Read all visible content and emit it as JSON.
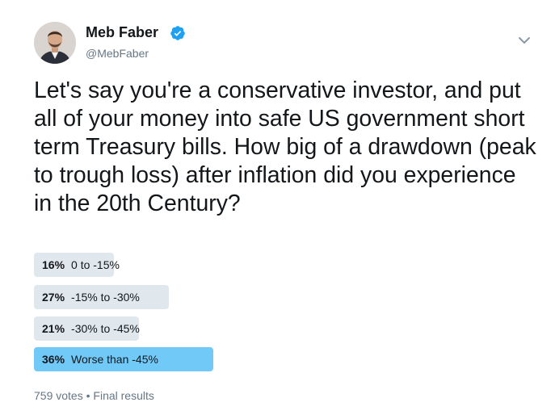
{
  "author": {
    "name": "Meb Faber",
    "handle": "@MebFaber",
    "verified": true,
    "badge_color": "#1da1f2"
  },
  "tweet": {
    "text": "Let's say you're a conservative investor, and put all of your money into safe US government short term Treasury bills.  How big of a drawdown (peak to trough loss) after inflation did you experience in the 20th Century?"
  },
  "poll": {
    "options": [
      {
        "percent_label": "16%",
        "label": "0 to -15%",
        "percent": 16,
        "winner": false
      },
      {
        "percent_label": "27%",
        "label": "-15% to -30%",
        "percent": 27,
        "winner": false
      },
      {
        "percent_label": "21%",
        "label": "-30% to -45%",
        "percent": 21,
        "winner": false
      },
      {
        "percent_label": "36%",
        "label": "Worse than -45%",
        "percent": 36,
        "winner": true
      }
    ],
    "votes": "759 votes",
    "separator": "•",
    "status": "Final results",
    "bar_color": "#e1e8ed",
    "winner_color": "#71c9f8"
  },
  "icons": {
    "verified": "verified-check-icon",
    "more": "chevron-down-icon"
  }
}
